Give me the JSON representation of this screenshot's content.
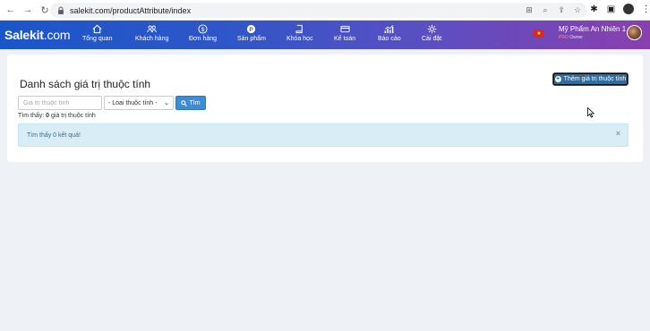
{
  "browser": {
    "url": "salekit.com/productAttribute/index"
  },
  "header": {
    "logo_main": "Salekit",
    "logo_domain": ".com",
    "menu": [
      {
        "label": "Tổng quan",
        "icon": "home-icon"
      },
      {
        "label": "Khách hàng",
        "icon": "users-icon"
      },
      {
        "label": "Đơn hàng",
        "icon": "dollar-icon"
      },
      {
        "label": "Sản phẩm",
        "icon": "product-icon"
      },
      {
        "label": "Khóa học",
        "icon": "book-icon"
      },
      {
        "label": "Kế toán",
        "icon": "card-icon"
      },
      {
        "label": "Báo cáo",
        "icon": "chart-icon"
      },
      {
        "label": "Cài đặt",
        "icon": "gear-icon"
      }
    ],
    "user_name": "Mỹ Phẩm An Nhiên 1",
    "user_badge": "PRO",
    "user_role": "Owner"
  },
  "main": {
    "title": "Danh sách giá trị thuộc tính",
    "add_button": "Thêm giá trị thuộc tính",
    "search_placeholder": "Giá trị thuộc tính",
    "type_select": "- Loại thuộc tính -",
    "find_button": "Tìm",
    "found_prefix": "Tìm thấy:",
    "found_count": "0",
    "found_suffix": "giá trị thuộc tính",
    "alert_text": "Tìm thấy 0 kết quả!",
    "alert_close": "×"
  },
  "colors": {
    "header_start": "#1a56c9",
    "header_end": "#8a3fae",
    "primary_button": "#2e6da4",
    "info_alert": "#d9edf7"
  }
}
